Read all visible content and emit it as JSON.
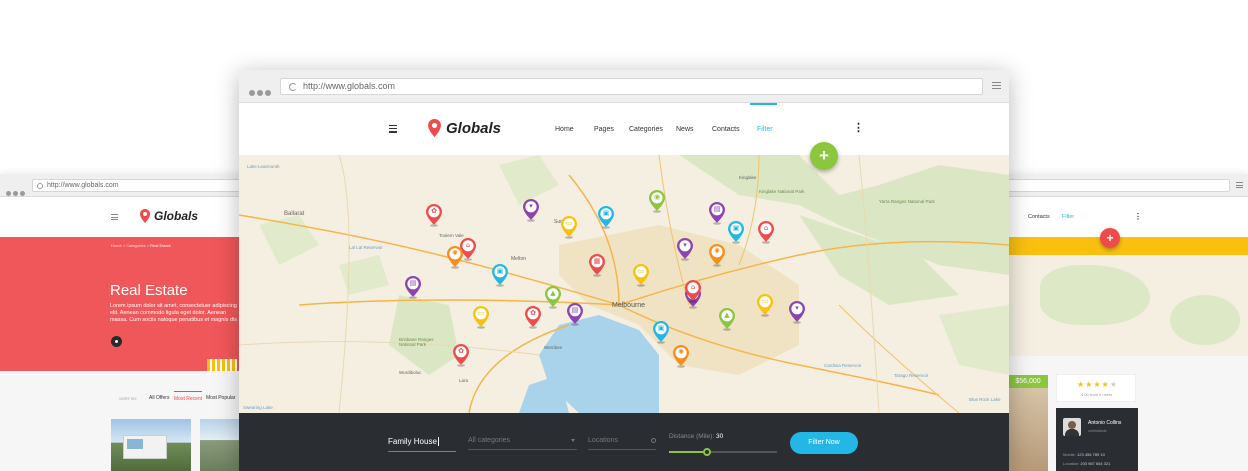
{
  "main": {
    "url": "http://www.globals.com",
    "logo": "Globals",
    "nav": [
      "Home",
      "Pages",
      "Categories",
      "News",
      "Contacts",
      "Filter"
    ],
    "active_nav": "Filter",
    "map_labels": [
      "Melbourne",
      "Ballarat",
      "Sunbury",
      "Melton",
      "Lake Learmonth",
      "Kinglake National Park",
      "Kinglake",
      "Yarra Ranges National Park",
      "Tarago Reservoir",
      "Lal Lal Reservoir",
      "Brisbane Ranges National Park",
      "Werribee",
      "Lara",
      "Cardinia Reservoir",
      "Blue Rock Lake",
      "Wurdiboluc",
      "Swearing Lake",
      "Toolern Vale"
    ],
    "filter": {
      "keyword": "Family House",
      "category_placeholder": "All categories",
      "location_placeholder": "Locations",
      "distance_label": "Distance (Mile):",
      "distance_value": "30",
      "distance_fraction": 0.22,
      "button": "Filter Now"
    },
    "fab": "+"
  },
  "left": {
    "url": "http://www.globals.com",
    "logo": "Globals",
    "breadcrumb": [
      "Home",
      "Categories",
      "Real Estate"
    ],
    "hero_title": "Real Estate",
    "hero_text": "Lorem ipsum dolor sit amet, consectetuer adipiscing elit. Aenean commodo ligula eget dolor. Aenean massa. Cum sociis natoque penatibus et magnis dis parturient montes, nascetur ridiculus mus. Donec quam felis, ultricies nec, pellentesque eu, pretium quis, sem. Nulla consequat massa quis enim. Donec pede justo, fringilla vel, aliquet nec, vulputate eget, arcu.",
    "sort_label": "SORT BY:",
    "sort_options": [
      "All Offers",
      "Most Recent",
      "Most Popular"
    ],
    "active_sort": "Most Recent",
    "hero_color": "#f0575a"
  },
  "right": {
    "nav": [
      "Contacts",
      "Filter"
    ],
    "price": "$56,000",
    "rating_text": "4.00 from 4 users",
    "rating_value": 4,
    "agent_name": "Antonio Collins",
    "agent_handle": "collinsfads",
    "agent_mobile_label": "Mobile:",
    "agent_mobile": "123 456 789 10",
    "agent_location_label": "Location:",
    "agent_location": "203 987 654 321",
    "band_color": "#f9c10e",
    "fab": "+"
  },
  "colors": {
    "accent": "#23b7e5",
    "logo_pin": "#ef4b4b",
    "fab_green": "#8cc63f",
    "fab_red": "#ef4b4b",
    "price_green": "#8cc63f",
    "filter_bar": "#2a2e33"
  },
  "markers": [
    {
      "color": "#ef4b4b",
      "icon": "paw-icon"
    },
    {
      "color": "#8e44ad",
      "icon": "basket-icon"
    },
    {
      "color": "#23b7e5",
      "icon": "cart-icon"
    },
    {
      "color": "#8cc63f",
      "icon": "camera-icon"
    },
    {
      "color": "#8e44ad",
      "icon": "building-icon"
    },
    {
      "color": "#ef4b4b",
      "icon": "house-icon"
    },
    {
      "color": "#23b7e5",
      "icon": "cart-icon"
    },
    {
      "color": "#f9c10e",
      "icon": "car-icon"
    },
    {
      "color": "#f98c1e",
      "icon": "gear-icon"
    },
    {
      "color": "#8e44ad",
      "icon": "basket-icon"
    },
    {
      "color": "#f98c1e",
      "icon": "gear-icon"
    },
    {
      "color": "#ef4b4b",
      "icon": "house-icon"
    },
    {
      "color": "#23b7e5",
      "icon": "cart-icon"
    },
    {
      "color": "#ef4b4b",
      "icon": "picture-icon"
    },
    {
      "color": "#f9c10e",
      "icon": "car-icon"
    },
    {
      "color": "#8e44ad",
      "icon": "building-icon"
    },
    {
      "color": "#8cc63f",
      "icon": "tree-icon"
    },
    {
      "color": "#f9c10e",
      "icon": "car-icon"
    },
    {
      "color": "#ef4b4b",
      "icon": "paw-icon"
    },
    {
      "color": "#8e44ad",
      "icon": "building-icon"
    },
    {
      "color": "#ef4b4b",
      "icon": "house-icon"
    },
    {
      "color": "#8e44ad",
      "icon": "building-icon"
    },
    {
      "color": "#f9c10e",
      "icon": "car-icon"
    },
    {
      "color": "#8cc63f",
      "icon": "tree-icon"
    },
    {
      "color": "#8e44ad",
      "icon": "basket-icon"
    },
    {
      "color": "#23b7e5",
      "icon": "cart-icon"
    },
    {
      "color": "#ef4b4b",
      "icon": "paw-icon"
    },
    {
      "color": "#f98c1e",
      "icon": "gear-icon"
    }
  ]
}
